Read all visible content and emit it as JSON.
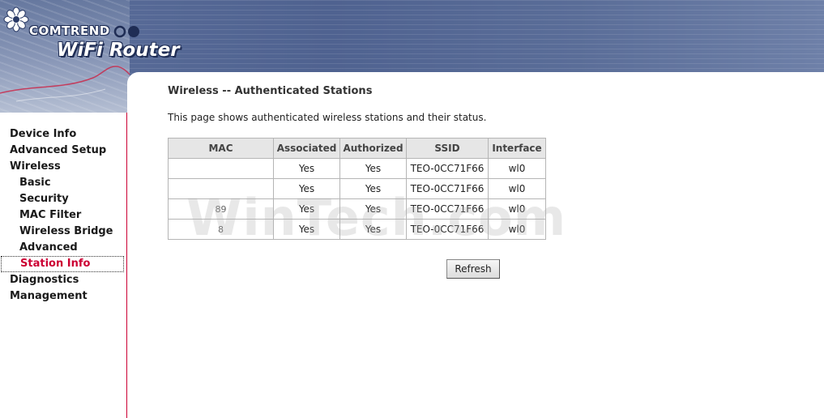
{
  "header": {
    "brand": "COMTREND",
    "product": "WiFi Router"
  },
  "sidebar": {
    "items": [
      {
        "label": "Device Info",
        "level": "top"
      },
      {
        "label": "Advanced Setup",
        "level": "top"
      },
      {
        "label": "Wireless",
        "level": "top"
      },
      {
        "label": "Basic",
        "level": "sub"
      },
      {
        "label": "Security",
        "level": "sub"
      },
      {
        "label": "MAC Filter",
        "level": "sub"
      },
      {
        "label": "Wireless Bridge",
        "level": "sub"
      },
      {
        "label": "Advanced",
        "level": "sub"
      },
      {
        "label": "Station Info",
        "level": "sub",
        "active": true
      },
      {
        "label": "Diagnostics",
        "level": "top"
      },
      {
        "label": "Management",
        "level": "top"
      }
    ]
  },
  "main": {
    "title": "Wireless -- Authenticated Stations",
    "description": "This page shows authenticated wireless stations and their status.",
    "table": {
      "headers": [
        "MAC",
        "Associated",
        "Authorized",
        "SSID",
        "Interface"
      ],
      "rows": [
        {
          "mac": "",
          "associated": "Yes",
          "authorized": "Yes",
          "ssid": "TEO-0CC71F66",
          "interface": "wl0"
        },
        {
          "mac": "",
          "associated": "Yes",
          "authorized": "Yes",
          "ssid": "TEO-0CC71F66",
          "interface": "wl0"
        },
        {
          "mac": "89",
          "associated": "Yes",
          "authorized": "Yes",
          "ssid": "TEO-0CC71F66",
          "interface": "wl0"
        },
        {
          "mac": "8",
          "associated": "Yes",
          "authorized": "Yes",
          "ssid": "TEO-0CC71F66",
          "interface": "wl0"
        }
      ]
    },
    "refresh_label": "Refresh"
  },
  "watermark": "WinTech.com",
  "colors": {
    "accent": "#cc0033",
    "banner": "#4f6290"
  }
}
